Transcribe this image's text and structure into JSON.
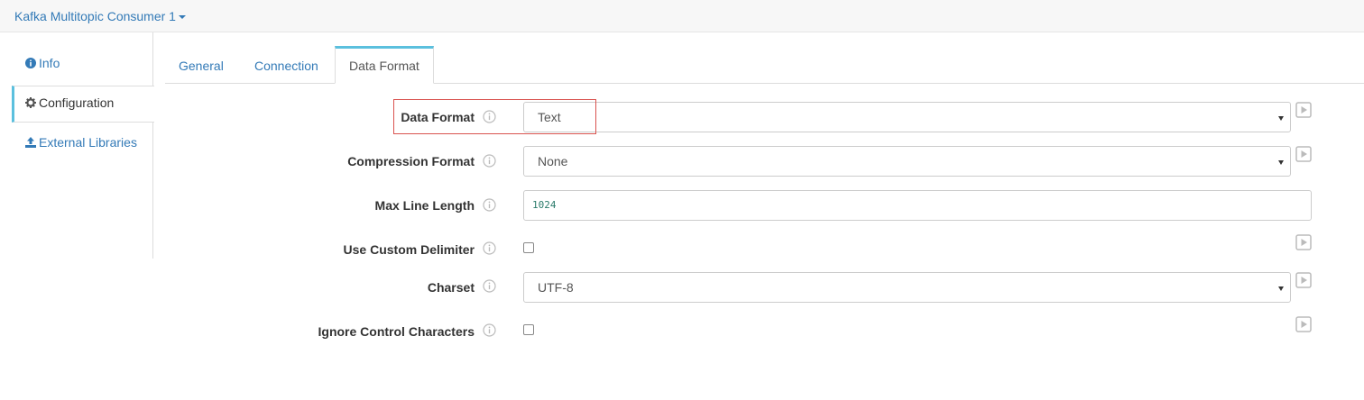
{
  "header": {
    "title": "Kafka Multitopic Consumer 1"
  },
  "sidebar": {
    "items": [
      {
        "label": "Info",
        "icon": "info-circle-icon",
        "active": false
      },
      {
        "label": "Configuration",
        "icon": "gear-icon",
        "active": true
      },
      {
        "label": "External Libraries",
        "icon": "upload-icon",
        "active": false
      }
    ]
  },
  "tabs": [
    {
      "label": "General",
      "active": false
    },
    {
      "label": "Connection",
      "active": false
    },
    {
      "label": "Data Format",
      "active": true
    }
  ],
  "fields": {
    "data_format": {
      "label": "Data Format",
      "value": "Text"
    },
    "compression_format": {
      "label": "Compression Format",
      "value": "None"
    },
    "max_line_length": {
      "label": "Max Line Length",
      "value": "1024"
    },
    "use_custom_delimiter": {
      "label": "Use Custom Delimiter",
      "checked": false
    },
    "charset": {
      "label": "Charset",
      "value": "UTF-8"
    },
    "ignore_control_characters": {
      "label": "Ignore Control Characters",
      "checked": false
    }
  },
  "colors": {
    "link": "#337ab7",
    "active_accent": "#5bc0de",
    "highlight_border": "#d9534f",
    "icon_gray": "#bbbbbb"
  }
}
